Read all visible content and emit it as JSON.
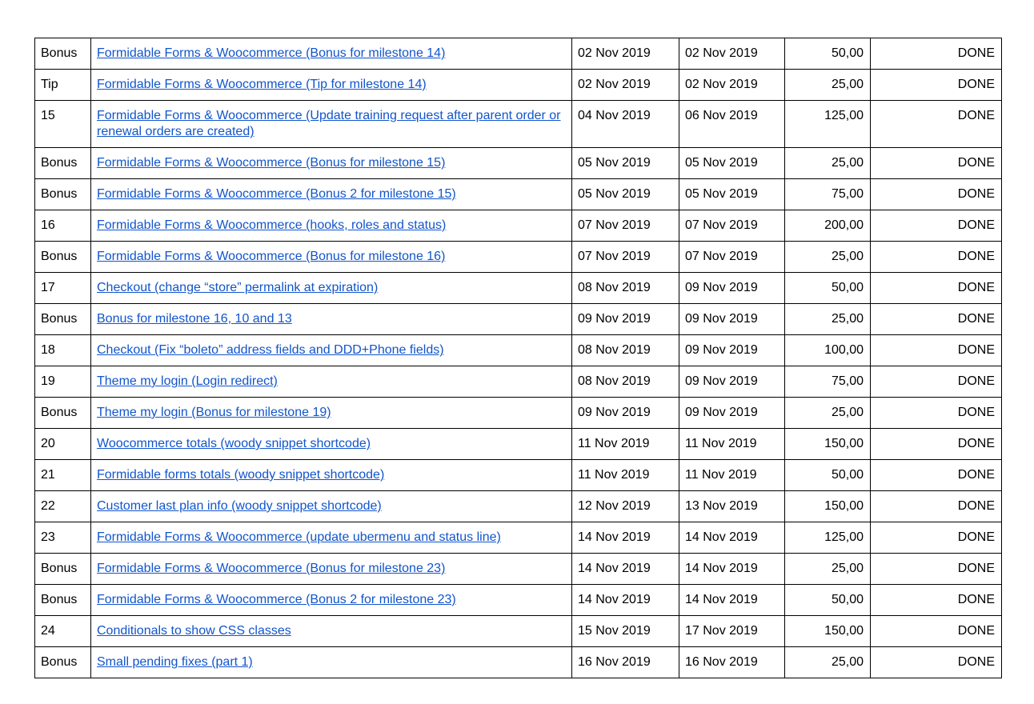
{
  "colors": {
    "link": "#1155cc",
    "border": "#000000",
    "text": "#000000"
  },
  "rows": [
    {
      "num": "Bonus",
      "title": "Formidable Forms & Woocommerce (Bonus for milestone 14)",
      "start": "02 Nov 2019",
      "end": "02 Nov 2019",
      "amount": "50,00",
      "status": "DONE"
    },
    {
      "num": "Tip",
      "title": "Formidable Forms & Woocommerce (Tip for milestone 14)",
      "start": "02 Nov 2019",
      "end": "02 Nov 2019",
      "amount": "25,00",
      "status": "DONE"
    },
    {
      "num": "15",
      "title": "Formidable Forms & Woocommerce (Update training request after parent order or renewal orders are created)",
      "start": "04 Nov 2019",
      "end": "06 Nov 2019",
      "amount": "125,00",
      "status": "DONE"
    },
    {
      "num": "Bonus",
      "title": "Formidable Forms & Woocommerce (Bonus for milestone 15)",
      "start": "05 Nov 2019",
      "end": "05 Nov 2019",
      "amount": "25,00",
      "status": "DONE"
    },
    {
      "num": "Bonus",
      "title": "Formidable Forms & Woocommerce (Bonus 2 for milestone 15)",
      "start": "05 Nov 2019",
      "end": "05 Nov 2019",
      "amount": "75,00",
      "status": "DONE"
    },
    {
      "num": "16",
      "title": "Formidable Forms & Woocommerce (hooks, roles and status)",
      "start": "07 Nov 2019",
      "end": "07 Nov 2019",
      "amount": "200,00",
      "status": "DONE"
    },
    {
      "num": "Bonus",
      "title": "Formidable Forms & Woocommerce (Bonus for milestone 16)",
      "start": "07 Nov 2019",
      "end": "07 Nov 2019",
      "amount": "25,00",
      "status": "DONE"
    },
    {
      "num": "17",
      "title": "Checkout (change “store” permalink at expiration)",
      "start": "08 Nov 2019",
      "end": "09 Nov 2019",
      "amount": "50,00",
      "status": "DONE"
    },
    {
      "num": "Bonus",
      "title": "Bonus for milestone 16, 10 and 13",
      "start": "09 Nov 2019",
      "end": "09 Nov 2019",
      "amount": "25,00",
      "status": "DONE"
    },
    {
      "num": "18",
      "title": "Checkout (Fix “boleto” address fields and DDD+Phone fields)",
      "start": "08 Nov 2019",
      "end": "09 Nov 2019",
      "amount": "100,00",
      "status": "DONE"
    },
    {
      "num": "19",
      "title": "Theme my login (Login redirect)",
      "start": "08 Nov 2019",
      "end": "09 Nov 2019",
      "amount": "75,00",
      "status": "DONE"
    },
    {
      "num": "Bonus",
      "title": "Theme my login (Bonus for milestone 19)",
      "start": "09 Nov 2019",
      "end": "09 Nov 2019",
      "amount": "25,00",
      "status": "DONE"
    },
    {
      "num": "20",
      "title": "Woocommerce totals (woody snippet shortcode)",
      "start": "11 Nov 2019",
      "end": "11 Nov 2019",
      "amount": "150,00",
      "status": "DONE"
    },
    {
      "num": "21",
      "title": "Formidable forms totals (woody snippet shortcode)",
      "start": "11 Nov 2019",
      "end": "11 Nov 2019",
      "amount": "50,00",
      "status": "DONE"
    },
    {
      "num": "22",
      "title": "Customer last plan info (woody snippet shortcode)",
      "start": "12 Nov 2019",
      "end": "13 Nov 2019",
      "amount": "150,00",
      "status": "DONE"
    },
    {
      "num": "23",
      "title": "Formidable Forms & Woocommerce (update ubermenu and status line)",
      "start": "14 Nov 2019",
      "end": "14 Nov 2019",
      "amount": "125,00",
      "status": "DONE"
    },
    {
      "num": "Bonus",
      "title": "Formidable Forms & Woocommerce (Bonus for milestone 23)",
      "start": "14 Nov 2019",
      "end": "14 Nov 2019",
      "amount": "25,00",
      "status": "DONE"
    },
    {
      "num": "Bonus",
      "title": "Formidable Forms & Woocommerce (Bonus 2 for milestone 23)",
      "start": "14 Nov 2019",
      "end": "14 Nov 2019",
      "amount": "50,00",
      "status": "DONE"
    },
    {
      "num": "24",
      "title": "Conditionals to show CSS classes",
      "start": "15 Nov 2019",
      "end": "17 Nov 2019",
      "amount": "150,00",
      "status": "DONE"
    },
    {
      "num": "Bonus",
      "title": "Small pending fixes (part 1)",
      "start": "16 Nov 2019",
      "end": "16 Nov 2019",
      "amount": "25,00",
      "status": "DONE"
    }
  ]
}
